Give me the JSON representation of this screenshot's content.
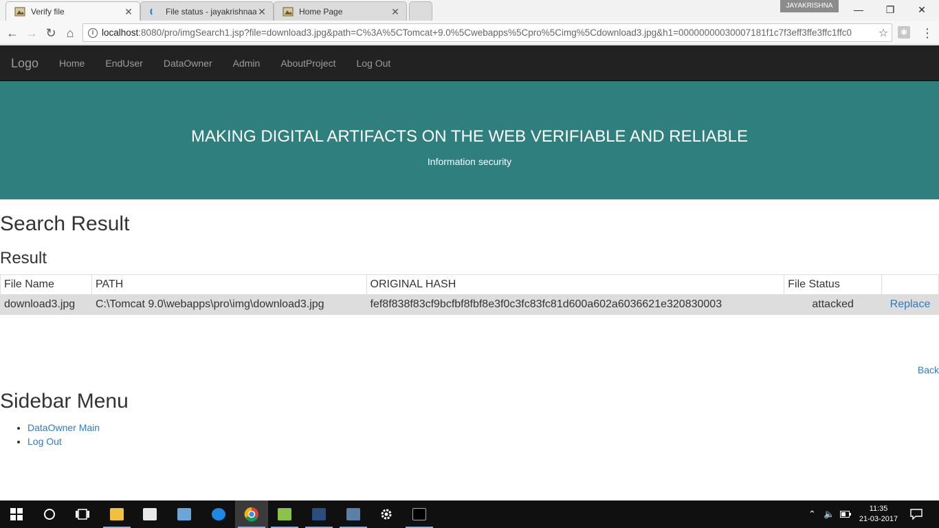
{
  "browser": {
    "tabs": [
      {
        "title": "Verify file",
        "active": true
      },
      {
        "title": "File status - jayakrishnaa",
        "active": false
      },
      {
        "title": "Home Page",
        "active": false
      }
    ],
    "close_glyph": "✕",
    "profile_name": "JAYAKRISHNA",
    "url_host": "localhost",
    "url_rest": ":8080/pro/imgSearch1.jsp?file=download3.jpg&path=C%3A%5CTomcat+9.0%5Cwebapps%5Cpro%5Cimg%5Cdownload3.jpg&h1=00000000030007181f1c7f3eff3ffe3ffc1ffc0"
  },
  "navbar": {
    "brand": "Logo",
    "links": [
      "Home",
      "EndUser",
      "DataOwner",
      "Admin",
      "AboutProject",
      "Log Out"
    ]
  },
  "hero": {
    "title": "MAKING DIGITAL ARTIFACTS ON THE WEB VERIFIABLE AND RELIABLE",
    "subtitle": "Information security"
  },
  "main": {
    "heading": "Search Result",
    "subheading": "Result",
    "table": {
      "columns": [
        "File Name",
        "PATH",
        "ORIGINAL HASH",
        "File Status",
        ""
      ],
      "rows": [
        {
          "file_name": "download3.jpg",
          "path": "C:\\Tomcat 9.0\\webapps\\pro\\img\\download3.jpg",
          "hash": "fef8f838f83cf9bcfbf8fbf8e3f0c3fc83fc81d600a602a6036621e320830003",
          "status": "attacked",
          "action": "Replace"
        }
      ]
    },
    "back_label": "Back"
  },
  "sidebar": {
    "heading": "Sidebar Menu",
    "items": [
      "DataOwner Main",
      "Log Out"
    ]
  },
  "taskbar": {
    "time": "11:35",
    "date": "21-03-2017"
  }
}
